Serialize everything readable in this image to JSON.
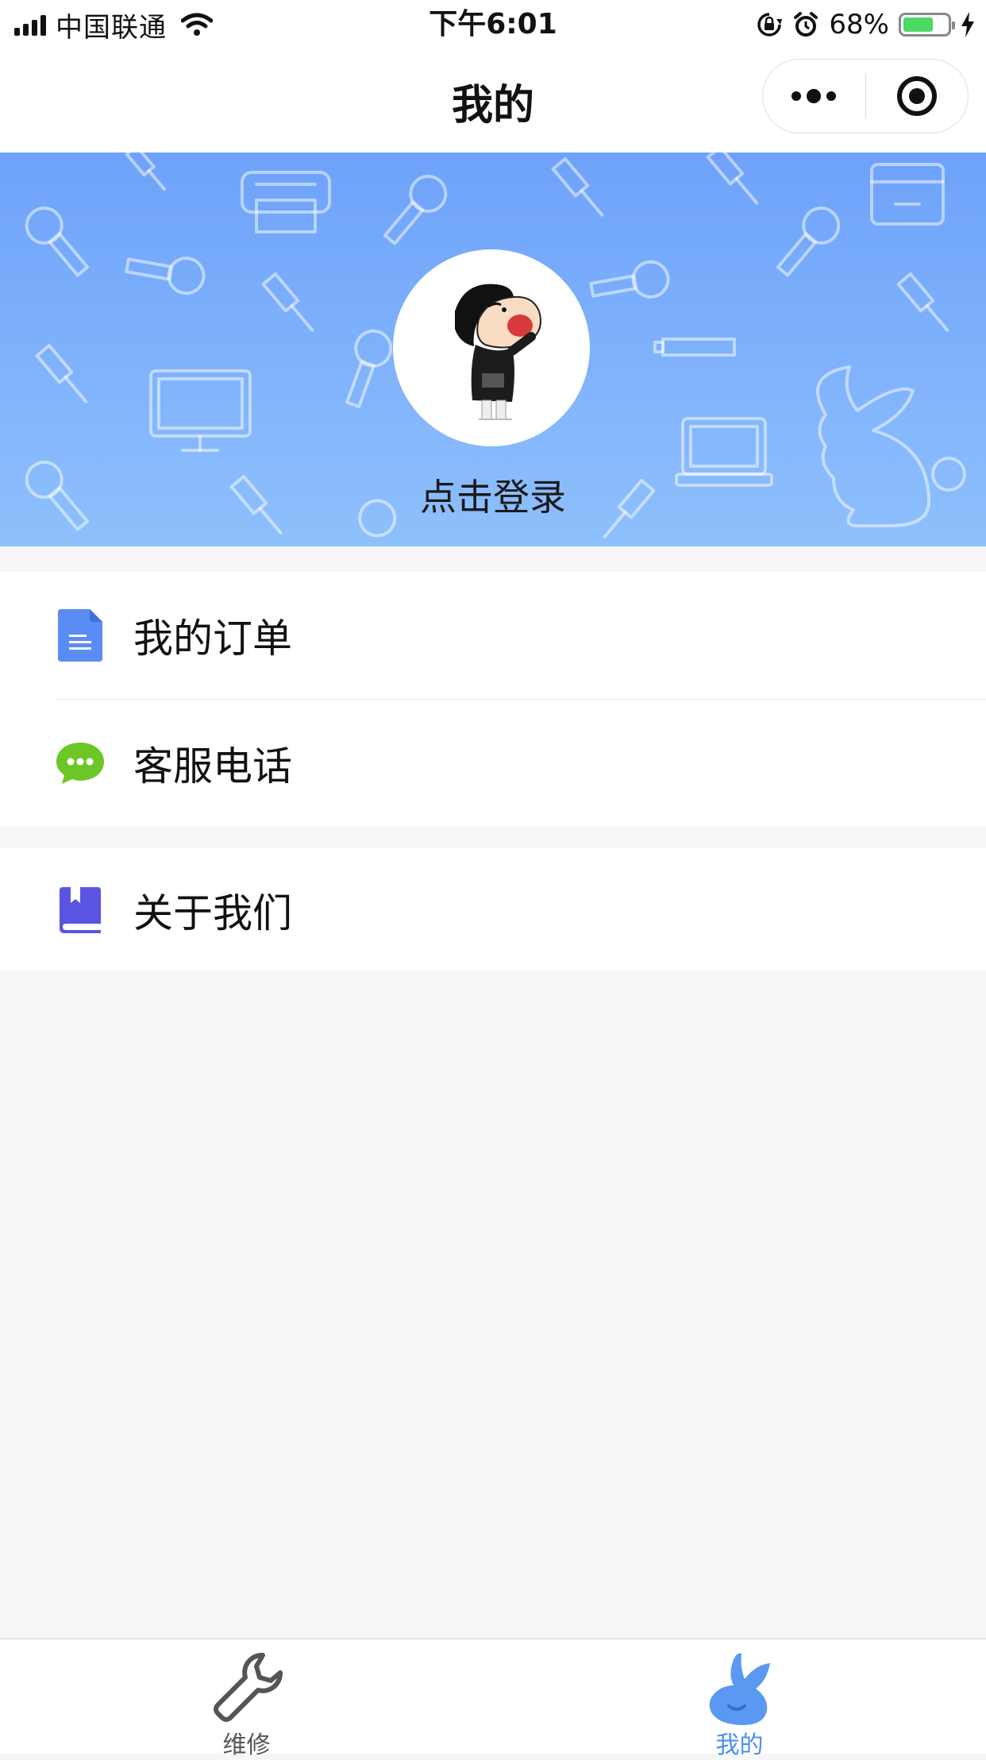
{
  "status_bar": {
    "carrier": "中国联通",
    "time": "下午6:01",
    "battery_percent": "68%",
    "battery_level": 0.68,
    "icons": [
      "signal-icon",
      "wifi-icon",
      "rotation-lock-icon",
      "alarm-icon",
      "battery-icon",
      "charging-icon"
    ]
  },
  "nav": {
    "title": "我的",
    "capsule": {
      "more_icon": "more-dots-icon",
      "close_icon": "target-icon"
    }
  },
  "profile": {
    "login_label": "点击登录",
    "avatar_icon": "cartoon-avatar"
  },
  "menu": {
    "group1": [
      {
        "label": "我的订单",
        "icon": "document-icon",
        "color": "#5b8cf5"
      },
      {
        "label": "客服电话",
        "icon": "chat-bubble-icon",
        "color": "#6cc726"
      }
    ],
    "group2": [
      {
        "label": "关于我们",
        "icon": "book-icon",
        "color": "#5a54e0"
      }
    ]
  },
  "tabbar": {
    "tabs": [
      {
        "label": "维修",
        "icon": "wrench-icon",
        "active": false
      },
      {
        "label": "我的",
        "icon": "rabbit-icon",
        "active": true
      }
    ],
    "active_color": "#4a8ef0",
    "inactive_color": "#555555"
  }
}
